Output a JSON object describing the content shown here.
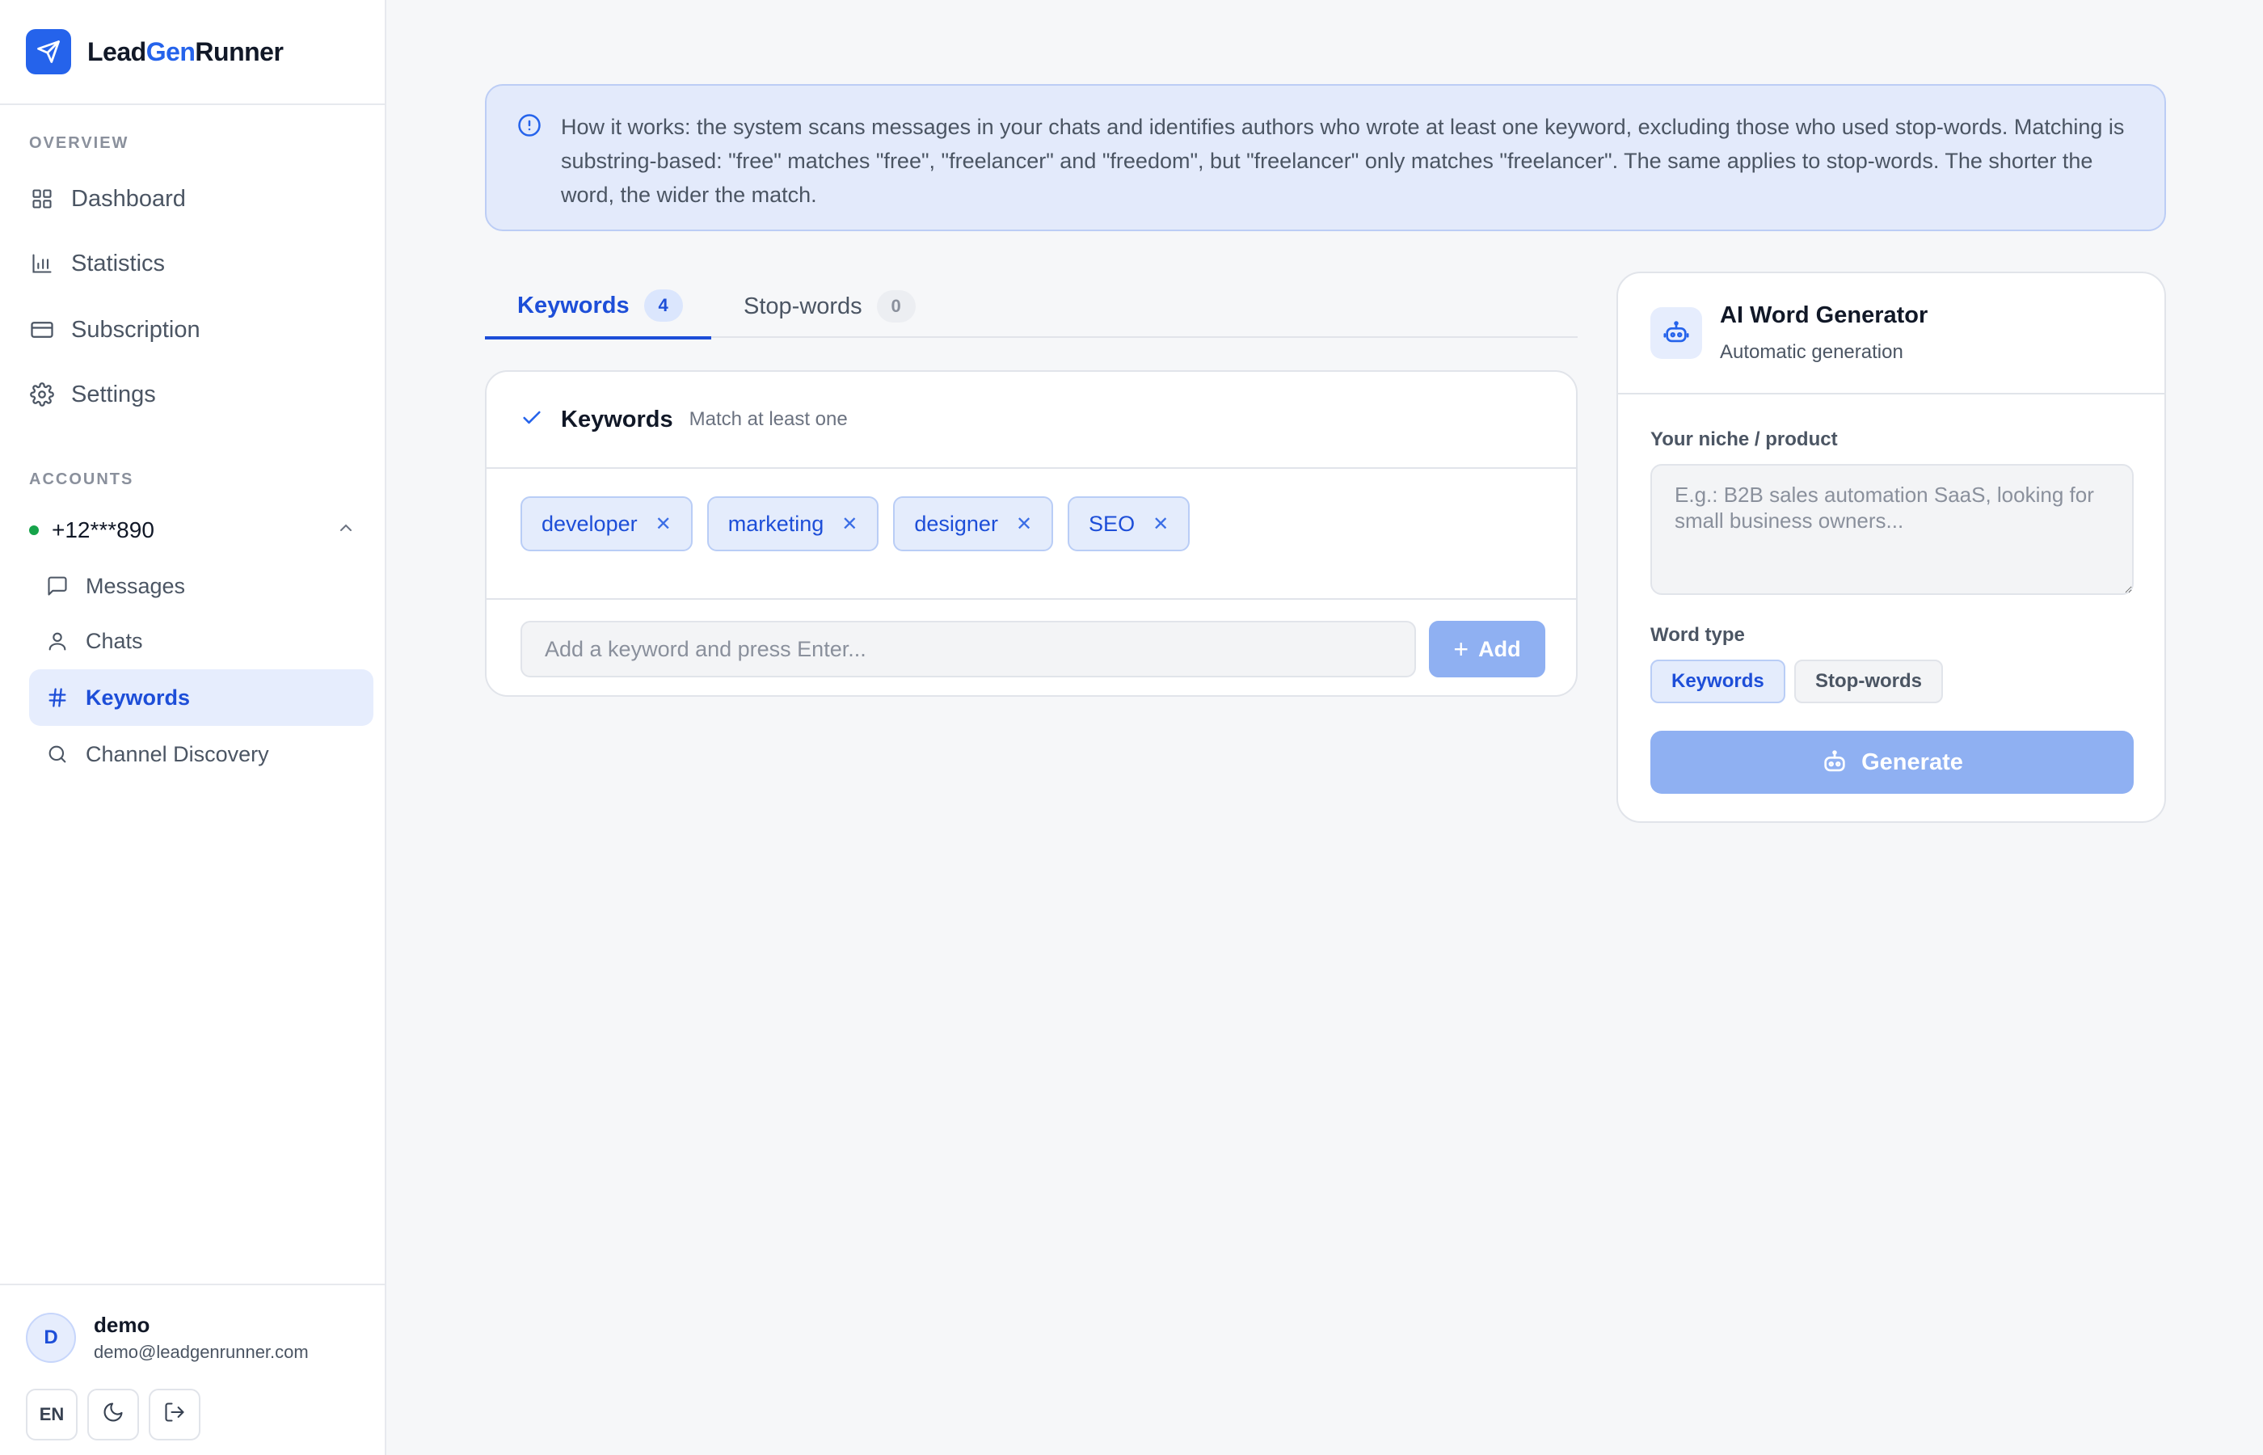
{
  "brand": {
    "part1": "Lead",
    "part2": "Gen",
    "part3": "Runner"
  },
  "sidebar": {
    "overview_label": "OVERVIEW",
    "nav": [
      {
        "label": "Dashboard",
        "icon": "grid-icon"
      },
      {
        "label": "Statistics",
        "icon": "bar-chart-icon"
      },
      {
        "label": "Subscription",
        "icon": "credit-card-icon"
      },
      {
        "label": "Settings",
        "icon": "gear-icon"
      }
    ],
    "accounts_label": "ACCOUNTS",
    "account": {
      "phone": "+12***890",
      "status_color": "#16a34a"
    },
    "sub_items": [
      {
        "label": "Messages",
        "icon": "message-icon"
      },
      {
        "label": "Chats",
        "icon": "user-icon"
      },
      {
        "label": "Keywords",
        "icon": "hash-icon",
        "active": true
      },
      {
        "label": "Channel Discovery",
        "icon": "search-icon"
      }
    ]
  },
  "user": {
    "initial": "D",
    "name": "demo",
    "email": "demo@leadgenrunner.com",
    "lang": "EN"
  },
  "info": {
    "text": "How it works: the system scans messages in your chats and identifies authors who wrote at least one keyword, excluding those who used stop-words. Matching is substring-based: \"free\" matches \"free\", \"freelancer\" and \"freedom\", but \"freelancer\" only matches \"freelancer\". The same applies to stop-words. The shorter the word, the wider the match."
  },
  "tabs": [
    {
      "label": "Keywords",
      "count": "4"
    },
    {
      "label": "Stop-words",
      "count": "0"
    }
  ],
  "keywords_card": {
    "title": "Keywords",
    "subtitle": "Match at least one",
    "chips": [
      "developer",
      "marketing",
      "designer",
      "SEO"
    ],
    "input_placeholder": "Add a keyword and press Enter...",
    "add_label": "Add"
  },
  "ai": {
    "title": "AI Word Generator",
    "subtitle": "Automatic generation",
    "niche_label": "Your niche / product",
    "niche_placeholder": "E.g.: B2B sales automation SaaS, looking for small business owners...",
    "type_label": "Word type",
    "type_options": [
      "Keywords",
      "Stop-words"
    ],
    "generate_label": "Generate"
  },
  "colors": {
    "accent": "#2563eb",
    "accent_light": "#e6edfd",
    "disabled_button": "#8fb0f2"
  }
}
